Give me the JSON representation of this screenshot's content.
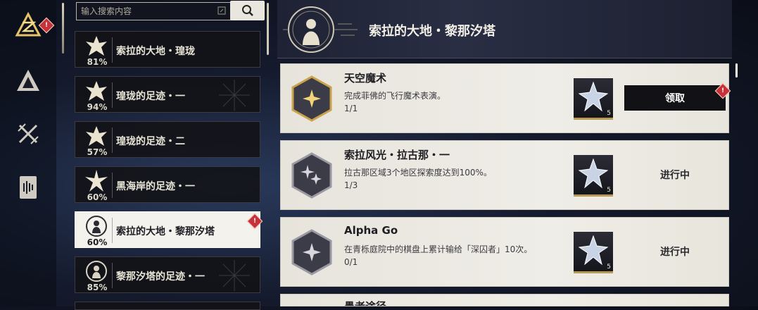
{
  "search": {
    "placeholder": "输入搜索内容"
  },
  "categories": [
    {
      "title": "索拉的大地・瑝珑",
      "percent": "81%"
    },
    {
      "title": "瑝珑的足迹・一",
      "percent": "94%"
    },
    {
      "title": "瑝珑的足迹・二",
      "percent": "57%"
    },
    {
      "title": "黑海岸的足迹・一",
      "percent": "60%"
    },
    {
      "title": "索拉的大地・黎那汐塔",
      "percent": "60%",
      "selected": true,
      "badge": "!"
    },
    {
      "title": "黎那汐塔的足迹・一",
      "percent": "85%"
    }
  ],
  "header": {
    "title": "索拉的大地・黎那汐塔"
  },
  "achievements": [
    {
      "title": "天空魔术",
      "description": "完成菲佛的飞行魔术表演。",
      "progress": "1/1",
      "reward_count": "5",
      "action": "领取",
      "badge": "!"
    },
    {
      "title": "索拉风光・拉古那・一",
      "description": "拉古那区域3个地区探索度达到100%。",
      "progress": "1/3",
      "reward_count": "5",
      "action": "进行中"
    },
    {
      "title": "Alpha Go",
      "description": "在青栎庭院中的棋盘上累计输给「深囚者」10次。",
      "progress": "0/1",
      "reward_count": "5",
      "action": "进行中"
    },
    {
      "title": "愚者途径"
    }
  ],
  "nav": {
    "badge": "!"
  },
  "colors": {
    "accent_gold": "#c9a24a",
    "badge_red": "#c8303a"
  }
}
